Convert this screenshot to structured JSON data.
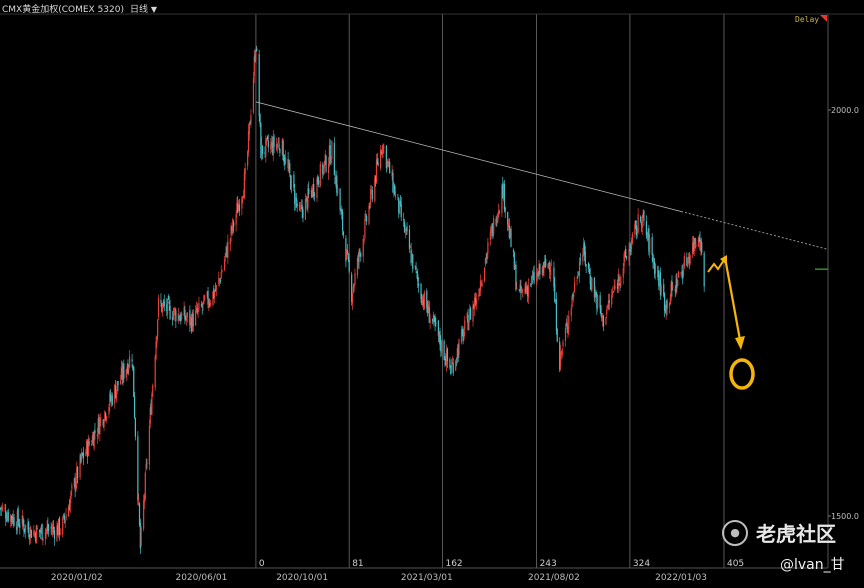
{
  "header": {
    "instrument": "CMX黄金加权(COMEX 5320)",
    "period": "日线",
    "delay_label": "Delay"
  },
  "watermark": {
    "brand": "老虎社区",
    "user": "@lvan_甘"
  },
  "colors": {
    "up": "#e8413a",
    "down": "#45c1c9",
    "trendline": "#bfbfbf",
    "annotation": "#f5b50a",
    "vline": "#6d6d6d",
    "price_marker": "#3fae3f"
  },
  "chart_data": {
    "type": "candlestick",
    "ylim": [
      1470,
      2090
    ],
    "y_ticks": [
      {
        "value": 2000,
        "label": "2000.0"
      },
      {
        "value": 1500,
        "label": "1500.0"
      }
    ],
    "x_date_labels": [
      "2020/01/02",
      "2020/06/01",
      "2020/10/01",
      "2021/03/01",
      "2021/08/02",
      "2022/01/03"
    ],
    "bar_count_markers": [
      {
        "count": 0,
        "label": "0"
      },
      {
        "count": 81,
        "label": "81"
      },
      {
        "count": 162,
        "label": "162"
      },
      {
        "count": 243,
        "label": "243"
      },
      {
        "count": 324,
        "label": "324"
      },
      {
        "count": 405,
        "label": "405"
      }
    ],
    "price_anchors": [
      {
        "date": "2019-10-01",
        "close": 1510
      },
      {
        "date": "2019-11-10",
        "close": 1480
      },
      {
        "date": "2019-12-15",
        "close": 1485
      },
      {
        "date": "2020-01-08",
        "close": 1570
      },
      {
        "date": "2020-02-20",
        "close": 1660
      },
      {
        "date": "2020-03-09",
        "close": 1700
      },
      {
        "date": "2020-03-19",
        "close": 1460
      },
      {
        "date": "2020-04-10",
        "close": 1760
      },
      {
        "date": "2020-05-20",
        "close": 1740
      },
      {
        "date": "2020-06-20",
        "close": 1780
      },
      {
        "date": "2020-07-25",
        "close": 1920
      },
      {
        "date": "2020-08-06",
        "close": 2085
      },
      {
        "date": "2020-08-12",
        "close": 1950
      },
      {
        "date": "2020-09-05",
        "close": 1960
      },
      {
        "date": "2020-09-28",
        "close": 1870
      },
      {
        "date": "2020-11-06",
        "close": 1950
      },
      {
        "date": "2020-11-30",
        "close": 1775
      },
      {
        "date": "2021-01-06",
        "close": 1960
      },
      {
        "date": "2021-02-20",
        "close": 1780
      },
      {
        "date": "2021-03-30",
        "close": 1680
      },
      {
        "date": "2021-04-30",
        "close": 1770
      },
      {
        "date": "2021-06-01",
        "close": 1905
      },
      {
        "date": "2021-06-20",
        "close": 1770
      },
      {
        "date": "2021-07-30",
        "close": 1815
      },
      {
        "date": "2021-08-09",
        "close": 1690
      },
      {
        "date": "2021-09-05",
        "close": 1830
      },
      {
        "date": "2021-09-30",
        "close": 1740
      },
      {
        "date": "2021-11-16",
        "close": 1870
      },
      {
        "date": "2021-12-15",
        "close": 1760
      },
      {
        "date": "2022-01-03",
        "close": 1800
      },
      {
        "date": "2022-01-25",
        "close": 1850
      },
      {
        "date": "2022-01-31",
        "close": 1795
      }
    ],
    "trendline": [
      {
        "date": "2020-08-06",
        "value": 2010
      },
      {
        "date": "2022-01-03",
        "value": 1875
      }
    ],
    "price_marker_value": 1804
  }
}
